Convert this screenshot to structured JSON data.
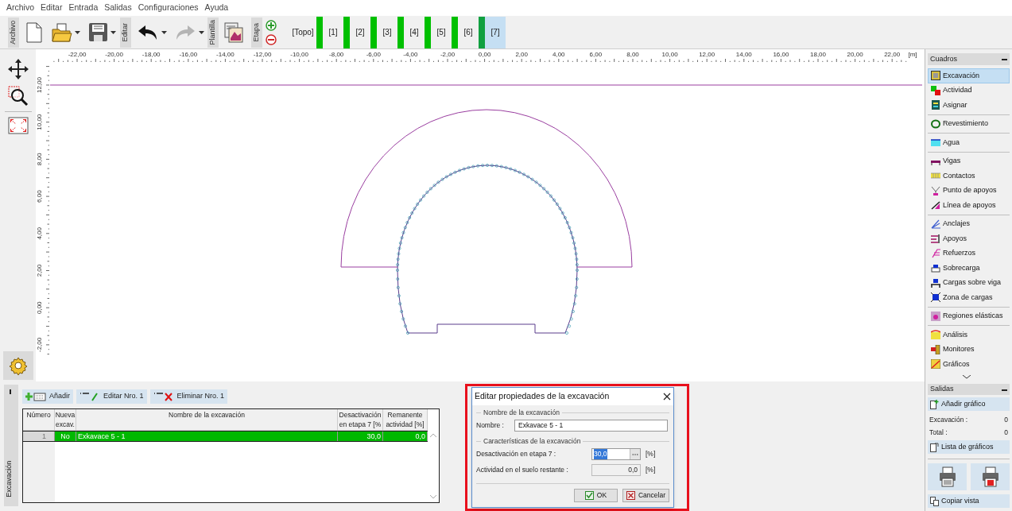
{
  "menu": [
    "Archivo",
    "Editar",
    "Entrada",
    "Salidas",
    "Configuraciones",
    "Ayuda"
  ],
  "toolbar": {
    "file_label": "Archivo",
    "edit_label": "Editar",
    "template_label": "Plantilla",
    "stage_label": "Etapa",
    "redo_disabled": true
  },
  "stages": [
    {
      "label": "[Topo]",
      "kind": "topo",
      "selected": false
    },
    {
      "label": "[1]",
      "kind": "stage",
      "selected": false
    },
    {
      "label": "[2]",
      "kind": "stage",
      "selected": false
    },
    {
      "label": "[3]",
      "kind": "stage",
      "selected": false
    },
    {
      "label": "[4]",
      "kind": "stage",
      "selected": false
    },
    {
      "label": "[5]",
      "kind": "stage",
      "selected": false
    },
    {
      "label": "[6]",
      "kind": "stage",
      "selected": false
    },
    {
      "label": "[7]",
      "kind": "stage",
      "selected": true
    }
  ],
  "ruler": {
    "x_labels": [
      "-22,00",
      "-20,00",
      "-18,00",
      "-16,00",
      "-14,00",
      "-12,00",
      "-10,00",
      "-8,00",
      "-6,00",
      "-4,00",
      "-2,00",
      "0,00",
      "2,00",
      "4,00",
      "6,00",
      "8,00",
      "10,00",
      "12,00",
      "14,00",
      "16,00",
      "18,00",
      "20,00",
      "22,00"
    ],
    "unit": "[m]",
    "y_labels": [
      "12,00",
      "10,00",
      "8,00",
      "6,00",
      "4,00",
      "2,00",
      "0,00",
      "-2,00"
    ]
  },
  "cuadros": {
    "title": "Cuadros",
    "groups": [
      [
        {
          "label": "Excavación",
          "selected": true
        },
        {
          "label": "Actividad",
          "selected": false
        },
        {
          "label": "Asignar",
          "selected": false
        }
      ],
      [
        {
          "label": "Revestimiento",
          "selected": false
        }
      ],
      [
        {
          "label": "Agua",
          "selected": false
        }
      ],
      [
        {
          "label": "Vigas",
          "selected": false
        },
        {
          "label": "Contactos",
          "selected": false
        },
        {
          "label": "Punto de apoyos",
          "selected": false
        },
        {
          "label": "Línea de apoyos",
          "selected": false
        }
      ],
      [
        {
          "label": "Anclajes",
          "selected": false
        },
        {
          "label": "Apoyos",
          "selected": false
        },
        {
          "label": "Refuerzos",
          "selected": false
        },
        {
          "label": "Sobrecarga",
          "selected": false
        },
        {
          "label": "Cargas sobre viga",
          "selected": false
        },
        {
          "label": "Zona de cargas",
          "selected": false
        }
      ],
      [
        {
          "label": "Regiones elásticas",
          "selected": false
        }
      ],
      [
        {
          "label": "Análisis",
          "selected": false
        },
        {
          "label": "Monitores",
          "selected": false
        },
        {
          "label": "Gráficos",
          "selected": false
        }
      ]
    ]
  },
  "bottom_panel": {
    "tab": "Excavación",
    "buttons": [
      "Añadir",
      "Editar Nro. 1",
      "Eliminar Nro. 1"
    ],
    "table": {
      "columns": [
        {
          "lines": [
            "Número"
          ]
        },
        {
          "lines": [
            "Nueva",
            "excav."
          ]
        },
        {
          "lines": [
            "Nombre de la excavación"
          ]
        },
        {
          "lines": [
            "Desactivación",
            "en etapa 7 [%"
          ]
        },
        {
          "lines": [
            "Remanente",
            "actividad [%]"
          ]
        }
      ],
      "rows": [
        {
          "cells": [
            "1",
            "No",
            "Exkavace 5 - 1",
            "30,0",
            "0,0"
          ],
          "selected": true
        }
      ]
    }
  },
  "dialog": {
    "title": "Editar propiedades de la excavación",
    "annotation_frame": true,
    "sections": [
      {
        "title": "Nombre de la excavación",
        "fields": [
          {
            "label": "Nombre :",
            "value": "Exkavace 5 - 1",
            "kind": "text",
            "highlighted": false,
            "disabled": false
          }
        ]
      },
      {
        "title": "Características de la excavación",
        "fields": [
          {
            "label": "Desactivación en etapa 7 :",
            "value": "30,0",
            "unit": "[%]",
            "kind": "picker",
            "highlighted": true,
            "disabled": false
          },
          {
            "label": "Actividad en el suelo restante :",
            "value": "0,0",
            "unit": "[%]",
            "kind": "number",
            "highlighted": false,
            "disabled": true
          }
        ]
      }
    ],
    "buttons": [
      {
        "label": "OK",
        "kind": "ok"
      },
      {
        "label": "Cancelar",
        "kind": "cancel"
      }
    ]
  },
  "salidas": {
    "title": "Salidas",
    "add_button": "Añadir gráfico",
    "counts": [
      {
        "label": "Excavación :",
        "value": "0"
      },
      {
        "label": "Total :",
        "value": "0"
      }
    ],
    "list_button": "Lista de gráficos",
    "copy_button": "Copiar vista"
  }
}
